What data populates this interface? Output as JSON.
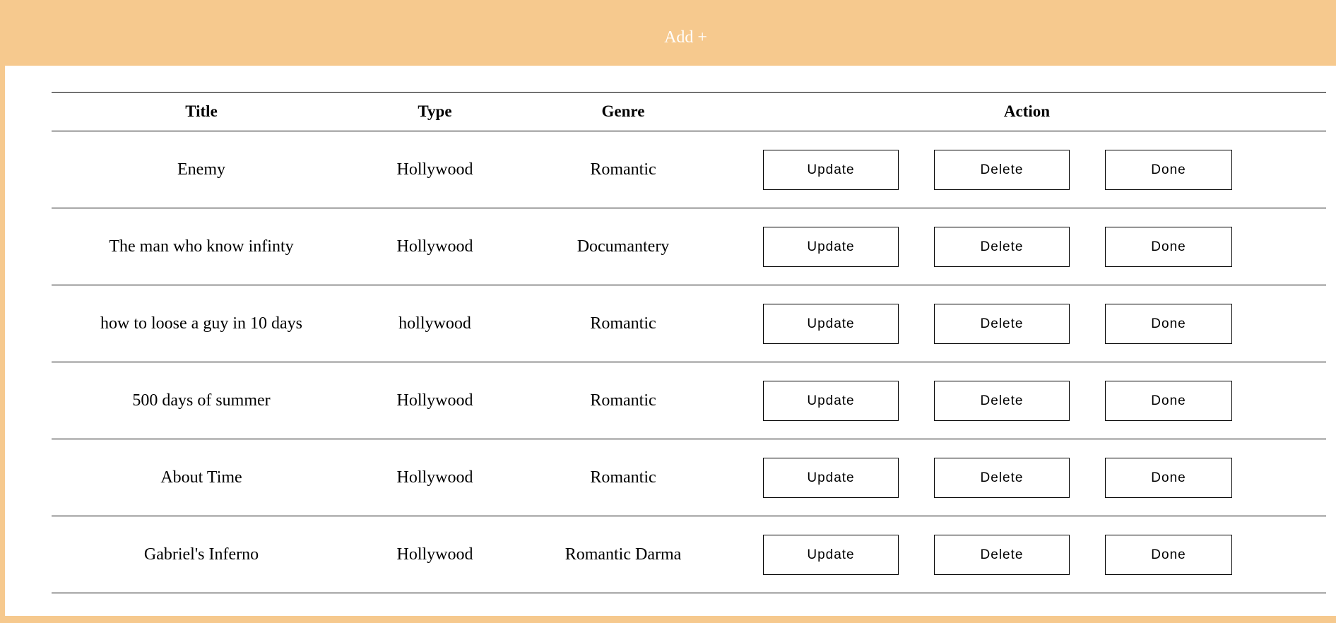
{
  "header": {
    "add_label": "Add +"
  },
  "table": {
    "columns": [
      "Title",
      "Type",
      "Genre",
      "Action"
    ],
    "rows": [
      {
        "title": "Enemy",
        "type": "Hollywood",
        "genre": "Romantic"
      },
      {
        "title": "The man who know infinty",
        "type": "Hollywood",
        "genre": "Documantery"
      },
      {
        "title": "how to loose a guy in 10 days",
        "type": "hollywood",
        "genre": "Romantic"
      },
      {
        "title": "500 days of summer",
        "type": "Hollywood",
        "genre": "Romantic"
      },
      {
        "title": "About Time",
        "type": "Hollywood",
        "genre": "Romantic"
      },
      {
        "title": "Gabriel's Inferno",
        "type": "Hollywood",
        "genre": "Romantic Darma"
      }
    ],
    "actions": {
      "update_label": "Update",
      "delete_label": "Delete",
      "done_label": "Done"
    }
  },
  "colors": {
    "background": "#f6c98e",
    "panel": "#ffffff",
    "text": "#000000",
    "add_text": "#ffffff"
  }
}
